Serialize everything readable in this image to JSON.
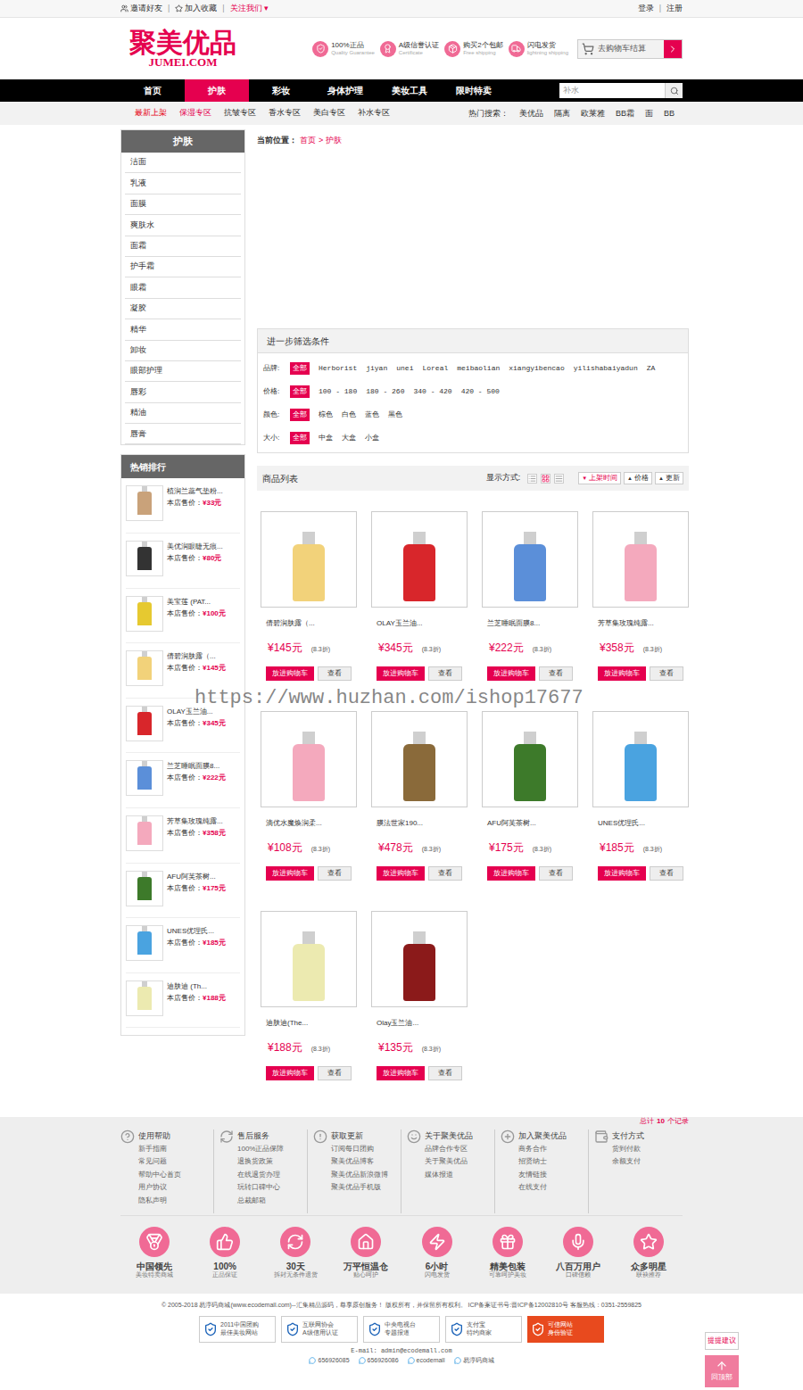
{
  "top_bar": {
    "left": [
      {
        "label": "邀请好友"
      },
      {
        "label": "加入收藏"
      },
      {
        "label": "关注我们",
        "arrow": "▾"
      }
    ],
    "right": [
      "登录",
      "注册"
    ],
    "separator": "|"
  },
  "logo": {
    "title": "聚美优品",
    "subtitle": "JUMEI.COM"
  },
  "features": [
    {
      "title": "100%正品",
      "sub": "Quality Guarantee"
    },
    {
      "title": "A级信誉认证",
      "sub": "Certificate"
    },
    {
      "title": "购买2个包邮",
      "sub": "Free shipping"
    },
    {
      "title": "闪电发货",
      "sub": "lightning shipping"
    }
  ],
  "cart_button": "去购物车结算",
  "nav": [
    {
      "label": "首页",
      "selected": false
    },
    {
      "label": "护肤",
      "selected": true
    },
    {
      "label": "彩妆",
      "selected": false
    },
    {
      "label": "身体护理",
      "selected": false
    },
    {
      "label": "美妆工具",
      "selected": false
    },
    {
      "label": "限时特卖",
      "selected": false
    }
  ],
  "search": {
    "placeholder": "补水"
  },
  "sub_nav": [
    {
      "label": "最新上架",
      "color": "#e60012"
    },
    {
      "label": "保湿专区",
      "color": "#e5004f"
    },
    {
      "label": "抗皱专区",
      "color": "#333333"
    },
    {
      "label": "香水专区",
      "color": "#333333"
    },
    {
      "label": "美白专区",
      "color": "#333333"
    },
    {
      "label": "补水专区",
      "color": "#333333"
    }
  ],
  "hot_search": {
    "label": "热门搜索：",
    "items": [
      "美优品",
      "隔离",
      "欧莱雅",
      "BB霜",
      "面",
      "BB"
    ]
  },
  "sidebar": {
    "title": "护肤",
    "items": [
      "洁面",
      "乳液",
      "面膜",
      "爽肤水",
      "面霜",
      "护手霜",
      "眼霜",
      "凝胶",
      "精华",
      "卸妆",
      "眼部护理",
      "唇彩",
      "精油",
      "唇膏"
    ]
  },
  "hot_ranking": {
    "title": "热销排行",
    "price_label": "本店售价：",
    "items": [
      {
        "name": "植润兰蕊气垫粉...",
        "price": "¥33元",
        "color": "#c9a27a"
      },
      {
        "name": "美优润眼睫无痕...",
        "price": "¥80元",
        "color": "#333333"
      },
      {
        "name": "美宝莲 (PAT...",
        "price": "¥100元",
        "color": "#e6c930"
      },
      {
        "name": "倩碧润肤露（...",
        "price": "¥145元",
        "color": "#f2d27a"
      },
      {
        "name": "OLAY玉兰油...",
        "price": "¥345元",
        "color": "#d8262b"
      },
      {
        "name": "兰芝睡眠面膜8...",
        "price": "¥222元",
        "color": "#5b8fd9"
      },
      {
        "name": "芳草集玫瑰纯露...",
        "price": "¥358元",
        "color": "#f4a9bd"
      },
      {
        "name": "AFU阿芙茶树...",
        "price": "¥175元",
        "color": "#3d7a2a"
      },
      {
        "name": "UNES优理氏...",
        "price": "¥185元",
        "color": "#4aa3e0"
      },
      {
        "name": "迪肤迪 (Th...",
        "price": "¥188元",
        "color": "#eceab0"
      }
    ]
  },
  "breadcrumb": {
    "label": "当前位置：",
    "items": [
      "首页",
      "护肤"
    ],
    "separator": ">"
  },
  "filter": {
    "title": "进一步筛选条件",
    "rows": [
      {
        "label": "品牌:",
        "options": [
          {
            "label": "全部",
            "selected": true
          },
          {
            "label": "Herborist",
            "selected": false
          },
          {
            "label": "jiyan",
            "selected": false
          },
          {
            "label": "unei",
            "selected": false
          },
          {
            "label": "Loreal",
            "selected": false
          },
          {
            "label": "meibaolian",
            "selected": false
          },
          {
            "label": "xiangyibencao",
            "selected": false
          },
          {
            "label": "yilishabaiyadun",
            "selected": false
          },
          {
            "label": "ZA",
            "selected": false
          }
        ]
      },
      {
        "label": "价格:",
        "options": [
          {
            "label": "全部",
            "selected": true
          },
          {
            "label": "100 - 180",
            "selected": false
          },
          {
            "label": "180 - 260",
            "selected": false
          },
          {
            "label": "340 - 420",
            "selected": false
          },
          {
            "label": "420 - 500",
            "selected": false
          }
        ]
      },
      {
        "label": "颜色:",
        "options": [
          {
            "label": "全部",
            "selected": true
          },
          {
            "label": "棕色",
            "selected": false
          },
          {
            "label": "白色",
            "selected": false
          },
          {
            "label": "蓝色",
            "selected": false
          },
          {
            "label": "黑色",
            "selected": false
          }
        ]
      },
      {
        "label": "大小:",
        "options": [
          {
            "label": "全部",
            "selected": true
          },
          {
            "label": "中盒",
            "selected": false
          },
          {
            "label": "大盒",
            "selected": false
          },
          {
            "label": "小盒",
            "selected": false
          }
        ]
      }
    ]
  },
  "product_list": {
    "title": "商品列表",
    "view_label": "显示方式:",
    "view_modes": [
      {
        "kind": "list",
        "selected": false
      },
      {
        "kind": "grid",
        "selected": true
      },
      {
        "kind": "text",
        "selected": false
      }
    ],
    "sorts": [
      {
        "label": "上架时间",
        "arrow": "▼",
        "selected": true
      },
      {
        "label": "价格",
        "arrow": "▲",
        "selected": false
      },
      {
        "label": "更新",
        "arrow": "▲",
        "selected": false
      }
    ],
    "cart_button": "放进购物车",
    "view_button": "查看",
    "items": [
      {
        "name": "倩碧润肤露（...",
        "price": "¥145元",
        "discount": "(8.3折)",
        "color": "#f2d27a"
      },
      {
        "name": "OLAY玉兰油...",
        "price": "¥345元",
        "discount": "(8.3折)",
        "color": "#d8262b"
      },
      {
        "name": "兰芝睡眠面膜8...",
        "price": "¥222元",
        "discount": "(8.3折)",
        "color": "#5b8fd9"
      },
      {
        "name": "芳草集玫瑰纯露...",
        "price": "¥358元",
        "discount": "(8.3折)",
        "color": "#f4a9bd"
      },
      {
        "name": "滴优水魔焕润柔...",
        "price": "¥108元",
        "discount": "(8.3折)",
        "color": "#f4a9bd"
      },
      {
        "name": "膜法世家190...",
        "price": "¥478元",
        "discount": "(8.3折)",
        "color": "#8a6a3a"
      },
      {
        "name": "AFU阿芙茶树...",
        "price": "¥175元",
        "discount": "(8.3折)",
        "color": "#3d7a2a"
      },
      {
        "name": "UNES优理氏...",
        "price": "¥185元",
        "discount": "(8.3折)",
        "color": "#4aa3e0"
      },
      {
        "name": "迪肤迪(The...",
        "price": "¥188元",
        "discount": "(8.3折)",
        "color": "#eceab0"
      },
      {
        "name": "Olay玉兰油...",
        "price": "¥135元",
        "discount": "(8.3折)",
        "color": "#8b1a1a"
      }
    ],
    "total": {
      "prefix": "总计",
      "count": "10",
      "suffix": "个记录"
    }
  },
  "watermark": "https://www.huzhan.com/ishop17677",
  "footer_columns": [
    {
      "title": "使用帮助",
      "links": [
        "新手指南",
        "常见问题",
        "帮助中心首页",
        "用户协议",
        "隐私声明"
      ]
    },
    {
      "title": "售后服务",
      "links": [
        "100%正品保障",
        "退换货政策",
        "在线退货办理",
        "玩转口碑中心",
        "总裁邮箱"
      ]
    },
    {
      "title": "获取更新",
      "links": [
        "订阅每日团购",
        "聚美优品博客",
        "聚美优品新浪微博",
        "聚美优品手机版"
      ]
    },
    {
      "title": "关于聚美优品",
      "links": [
        "品牌合作专区",
        "关于聚美优品",
        "媒体报道"
      ]
    },
    {
      "title": "加入聚美优品",
      "links": [
        "商务合作",
        "招贤纳士",
        "友情链接",
        "在线支付"
      ]
    },
    {
      "title": "支付方式",
      "links": [
        "货到付款",
        "余额支付"
      ]
    }
  ],
  "promises": [
    {
      "title": "中国领先",
      "sub": "美妆特卖商城"
    },
    {
      "title": "100%",
      "sub": "正品保证"
    },
    {
      "title": "30天",
      "sub": "拆封无条件退货"
    },
    {
      "title": "万平恒温仓",
      "sub": "贴心呵护"
    },
    {
      "title": "6小时",
      "sub": "闪电发货"
    },
    {
      "title": "精美包装",
      "sub": "可靠呵护美妆"
    },
    {
      "title": "八百万用户",
      "sub": "口碑信赖"
    },
    {
      "title": "众多明星",
      "sub": "联袂推荐"
    }
  ],
  "copyright": "© 2005-2018 易淳码商城(www.ecodemall.com)--汇集精品源码，尊享原创服务！ 版权所有，并保留所有权利。 ICP备案证书号:晋ICP备12002810号 客服热线：0351-2559825",
  "badges": [
    {
      "line1": "2011中国团购",
      "line2": "最佳美妆网站"
    },
    {
      "line1": "互联网协会",
      "line2": "A级信用认证"
    },
    {
      "line1": "中央电视台",
      "line2": "专题报道"
    },
    {
      "line1": "支付宝",
      "line2": "特约商家"
    },
    {
      "line1": "可信网站",
      "line2": "身份验证"
    }
  ],
  "email": "E-mail: admin@ecodemall.com",
  "contacts": [
    "656926085",
    "656926086",
    "ecodemall",
    "易淳码商城"
  ],
  "float_buttons": {
    "suggest": "提提建议",
    "top": "回顶部"
  }
}
